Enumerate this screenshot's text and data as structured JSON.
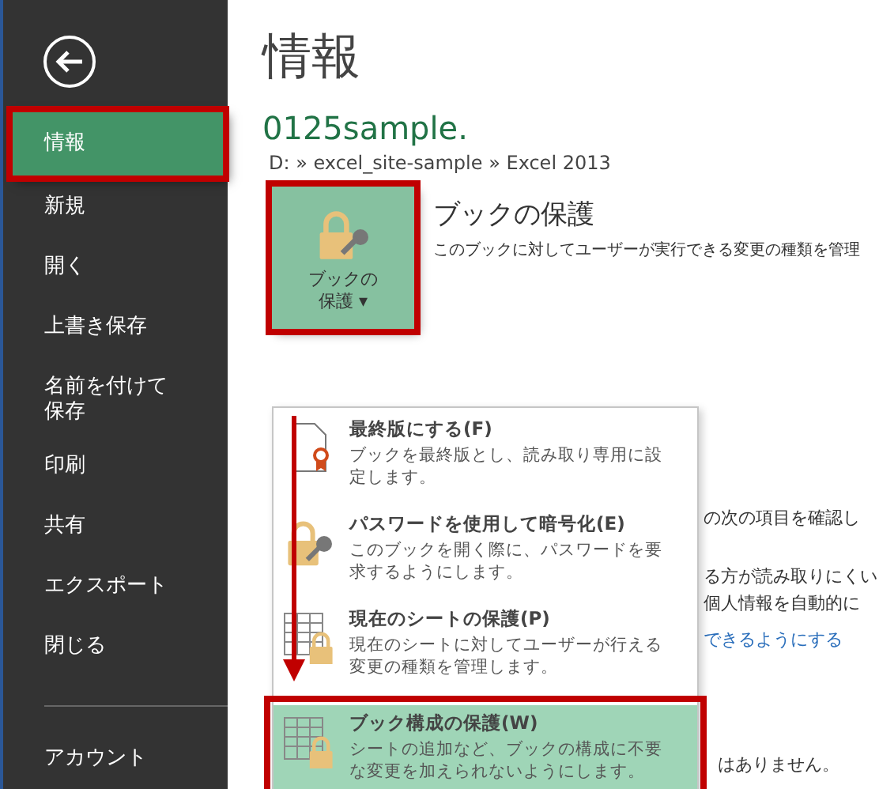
{
  "sidebar": {
    "items": [
      {
        "label": "情報",
        "selected": true,
        "highlighted": true
      },
      {
        "label": "新規",
        "selected": false,
        "highlighted": false
      },
      {
        "label": "開く",
        "selected": false,
        "highlighted": false
      },
      {
        "label": "上書き保存",
        "selected": false,
        "highlighted": false
      },
      {
        "label": "名前を付けて保存",
        "selected": false,
        "highlighted": false
      },
      {
        "label": "印刷",
        "selected": false,
        "highlighted": false
      },
      {
        "label": "共有",
        "selected": false,
        "highlighted": false
      },
      {
        "label": "エクスポート",
        "selected": false,
        "highlighted": false
      },
      {
        "label": "閉じる",
        "selected": false,
        "highlighted": false
      }
    ],
    "footer_items": [
      {
        "label": "アカウント",
        "selected": false
      }
    ]
  },
  "page": {
    "title": "情報",
    "file_name": "0125sample.",
    "path": "D: » excel_site-sample » Excel 2013"
  },
  "protect": {
    "button_label": "ブックの保護",
    "button_caret": "▾",
    "button_highlighted": true,
    "heading": "ブックの保護",
    "description": "このブックに対してユーザーが実行できる変更の種類を管理"
  },
  "background_lines": [
    {
      "kind": "text",
      "text": "の次の項目を確認し"
    },
    {
      "kind": "text",
      "text": "る方が読み取りにくい"
    },
    {
      "kind": "text",
      "text": "個人情報を自動的に"
    },
    {
      "kind": "link",
      "text": "できるようにする"
    },
    {
      "kind": "text",
      "text": "はありません。"
    }
  ],
  "menu": {
    "items": [
      {
        "kind": "final",
        "title": "最終版にする(F)",
        "description": "ブックを最終版とし、読み取り専用に設定します。",
        "selected": false,
        "highlighted": false
      },
      {
        "kind": "password",
        "title": "パスワードを使用して暗号化(E)",
        "description": "このブックを開く際に、パスワードを要求するようにします。",
        "selected": false,
        "highlighted": false
      },
      {
        "kind": "sheet",
        "title": "現在のシートの保護(P)",
        "description": "現在のシートに対してユーザーが行える変更の種類を管理します。",
        "selected": false,
        "highlighted": false
      },
      {
        "kind": "structure",
        "title": "ブック構成の保護(W)",
        "description": "シートの追加など、ブックの構成に不要な変更を加えられないようにします。",
        "selected": true,
        "highlighted": true
      }
    ]
  },
  "annotation_arrow": true
}
